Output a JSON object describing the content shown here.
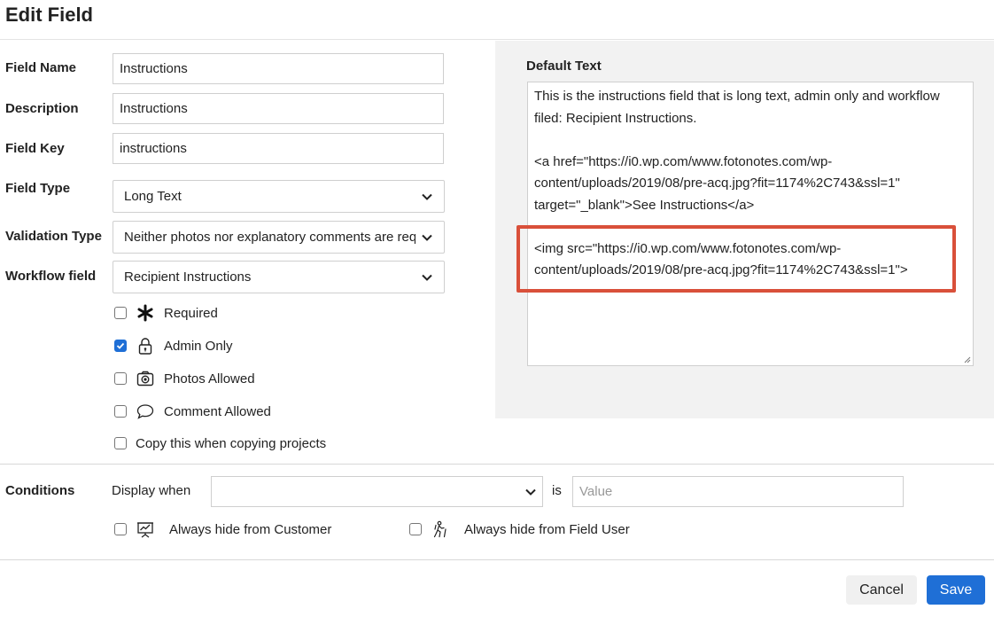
{
  "dialog": {
    "title": "Edit Field"
  },
  "form": {
    "field_name": {
      "label": "Field Name",
      "value": "Instructions"
    },
    "description": {
      "label": "Description",
      "value": "Instructions"
    },
    "field_key": {
      "label": "Field Key",
      "value": "instructions"
    },
    "field_type": {
      "label": "Field Type",
      "value": "Long Text"
    },
    "validation_type": {
      "label": "Validation Type",
      "value": "Neither photos nor explanatory comments are required"
    },
    "workflow_field": {
      "label": "Workflow field",
      "value": "Recipient Instructions"
    }
  },
  "options": {
    "required": {
      "label": "Required",
      "checked": false,
      "icon": "asterisk-icon"
    },
    "admin_only": {
      "label": "Admin Only",
      "checked": true,
      "icon": "lock-icon"
    },
    "photos_allowed": {
      "label": "Photos Allowed",
      "checked": false,
      "icon": "camera-icon"
    },
    "comment_allowed": {
      "label": "Comment Allowed",
      "checked": false,
      "icon": "speech-bubble-icon"
    },
    "copy_when_copying": {
      "label": "Copy this when copying projects",
      "checked": false
    }
  },
  "default_text": {
    "label": "Default Text",
    "paragraphs": [
      "This is the instructions field that is long text, admin only and workflow filed: Recipient Instructions.",
      "<a href=\"https://i0.wp.com/www.fotonotes.com/wp-content/uploads/2019/08/pre-acq.jpg?fit=1174%2C743&ssl=1\" target=\"_blank\">See Instructions</a>",
      "<img src=\"https://i0.wp.com/www.fotonotes.com/wp-content/uploads/2019/08/pre-acq.jpg?fit=1174%2C743&ssl=1\">"
    ],
    "highlight_color": "#d9503a"
  },
  "conditions": {
    "label": "Conditions",
    "display_when": "Display when",
    "selected": "",
    "is": "is",
    "value_placeholder": "Value",
    "hide_customer": {
      "label": "Always hide from Customer",
      "checked": false,
      "icon": "presentation-chart-icon"
    },
    "hide_field_user": {
      "label": "Always hide from Field User",
      "checked": false,
      "icon": "hiker-icon"
    }
  },
  "actions": {
    "cancel": "Cancel",
    "save": "Save"
  },
  "colors": {
    "accent": "#1f6fd6",
    "panel": "#f2f2f2"
  }
}
